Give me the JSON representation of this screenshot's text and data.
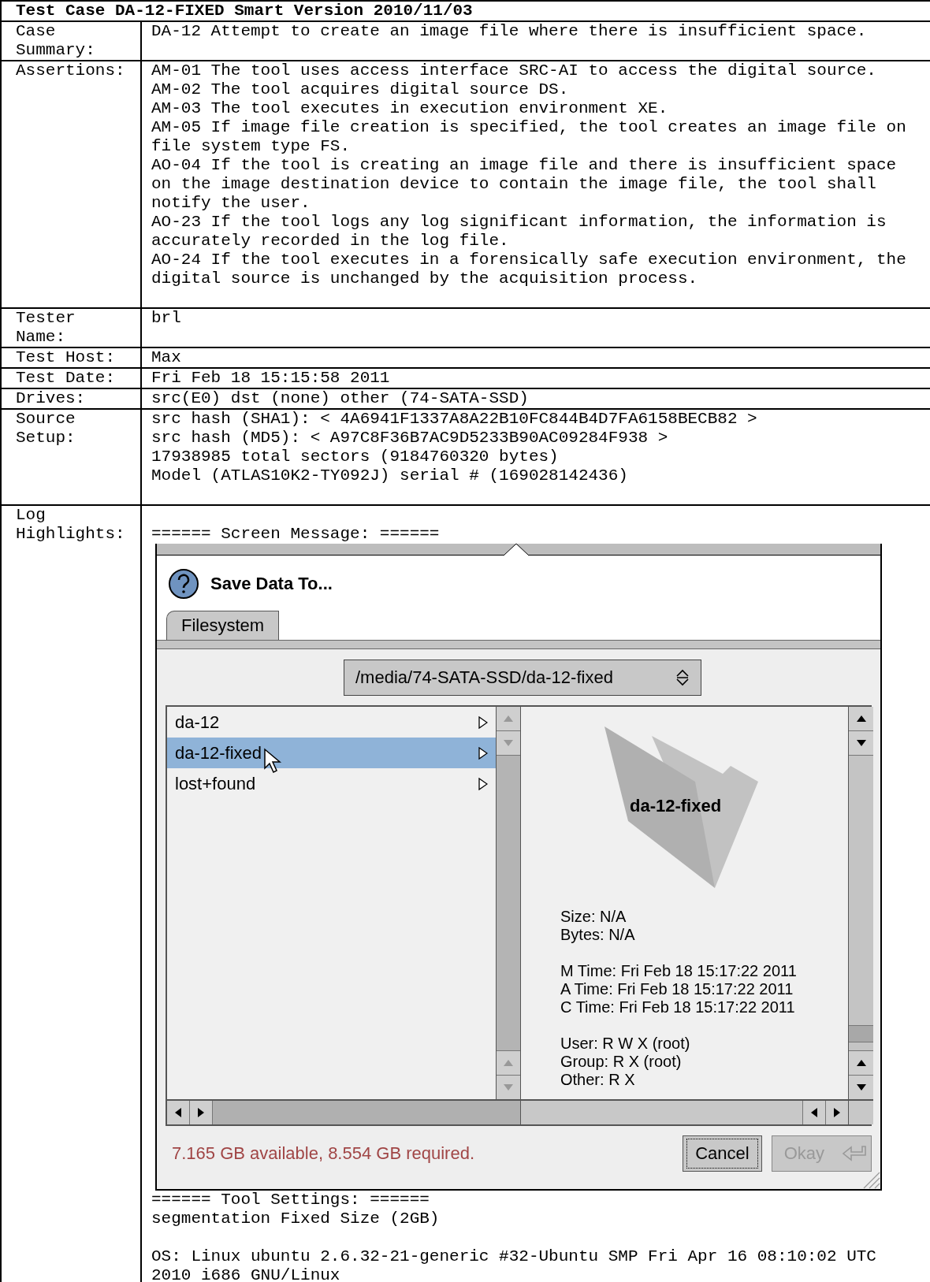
{
  "title": "Test Case DA-12-FIXED Smart Version 2010/11/03",
  "rows": [
    {
      "label": "Case Summary:",
      "lines": [
        "DA-12 Attempt to create an image file where there is insufficient space."
      ]
    },
    {
      "label": "Assertions:",
      "lines": [
        "AM-01 The tool uses access interface SRC-AI to access the digital source.",
        "AM-02 The tool acquires digital source DS.",
        "AM-03 The tool executes in execution environment XE.",
        "AM-05 If image file creation is specified, the tool creates an image file on file system type FS.",
        "AO-04 If the tool is creating an image file and there is insufficient space on the image destination device to contain the image file, the tool shall notify the user.",
        "AO-23 If the tool logs any log significant information, the information is accurately recorded in the log file.",
        "AO-24 If the tool executes in a forensically safe execution environment, the digital source is unchanged by the acquisition process."
      ]
    },
    {
      "label": "Tester Name:",
      "lines": [
        "brl"
      ]
    },
    {
      "label": "Test Host:",
      "lines": [
        "Max"
      ]
    },
    {
      "label": "Test Date:",
      "lines": [
        "Fri Feb 18 15:15:58 2011"
      ]
    },
    {
      "label": "Drives:",
      "lines": [
        "src(E0) dst (none) other (74-SATA-SSD)"
      ]
    },
    {
      "label": "Source Setup:",
      "lines": [
        "src hash (SHA1): < 4A6941F1337A8A22B10FC844B4D7FA6158BECB82 >",
        "src hash (MD5): < A97C8F36B7AC9D5233B90AC09284F938 >",
        "17938985 total sectors (9184760320 bytes)",
        "Model (ATLAS10K2-TY092J) serial # (169028142436)"
      ]
    }
  ],
  "log": {
    "label": "Log Highlights:",
    "before": "====== Screen Message: ======",
    "dialog": {
      "title": "Save Data To...",
      "tabs": [
        {
          "label": "Filesystem",
          "selected": true
        }
      ],
      "path": "/media/74-SATA-SSD/da-12-fixed",
      "entries": [
        {
          "name": "da-12",
          "selected": false
        },
        {
          "name": "da-12-fixed",
          "selected": true
        },
        {
          "name": "lost+found",
          "selected": false
        }
      ],
      "preview": {
        "name": "da-12-fixed",
        "info_groups": [
          [
            "Size: N/A",
            "Bytes: N/A"
          ],
          [
            "M Time: Fri Feb 18 15:17:22 2011",
            "A Time: Fri Feb 18 15:17:22 2011",
            "C Time: Fri Feb 18 15:17:22 2011"
          ],
          [
            "User: R W X  (root)",
            "Group: R X  (root)",
            "Other: R X"
          ]
        ]
      },
      "message": "7.165 GB available, 8.554 GB required.",
      "buttons": [
        {
          "label": "Cancel",
          "kind": "plain",
          "disabled": false,
          "focused": true
        },
        {
          "label": "Okay",
          "kind": "default",
          "disabled": true,
          "focused": false
        }
      ]
    },
    "after_groups": [
      [
        "====== Tool Settings: ======",
        "segmentation Fixed Size (2GB)"
      ],
      [
        "OS: Linux ubuntu 2.6.32-21-generic #32-Ubuntu SMP Fri Apr 16 08:10:02 UTC 2010 i686 GNU/Linux"
      ]
    ]
  }
}
